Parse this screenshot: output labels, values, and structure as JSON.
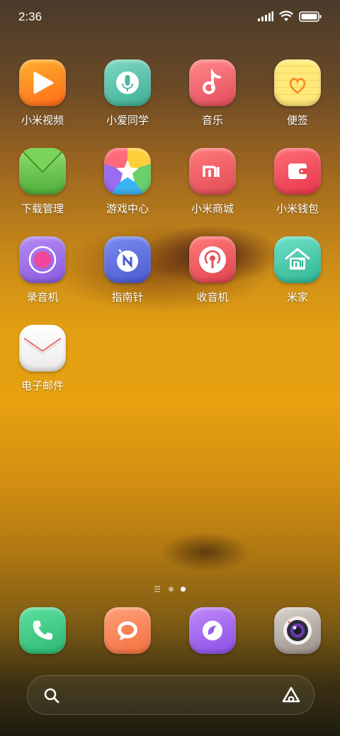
{
  "status_bar": {
    "time": "2:36"
  },
  "apps": [
    {
      "label": "小米视频",
      "icon": "video-play-icon"
    },
    {
      "label": "小爱同学",
      "icon": "microphone-icon"
    },
    {
      "label": "音乐",
      "icon": "music-note-icon"
    },
    {
      "label": "便签",
      "icon": "notes-heart-icon"
    },
    {
      "label": "下载管理",
      "icon": "download-icon"
    },
    {
      "label": "游戏中心",
      "icon": "game-star-icon"
    },
    {
      "label": "小米商城",
      "icon": "mi-store-icon"
    },
    {
      "label": "小米钱包",
      "icon": "wallet-icon"
    },
    {
      "label": "录音机",
      "icon": "recorder-icon"
    },
    {
      "label": "指南针",
      "icon": "compass-icon"
    },
    {
      "label": "收音机",
      "icon": "radio-icon"
    },
    {
      "label": "米家",
      "icon": "mi-home-icon"
    },
    {
      "label": "电子邮件",
      "icon": "email-icon"
    }
  ],
  "page_indicator": {
    "pages": 2,
    "current": 2
  },
  "dock": [
    {
      "icon": "phone-icon"
    },
    {
      "icon": "messages-icon"
    },
    {
      "icon": "browser-icon"
    },
    {
      "icon": "camera-icon"
    }
  ],
  "search": {
    "icons": [
      "search-icon",
      "assistant-icon"
    ]
  }
}
